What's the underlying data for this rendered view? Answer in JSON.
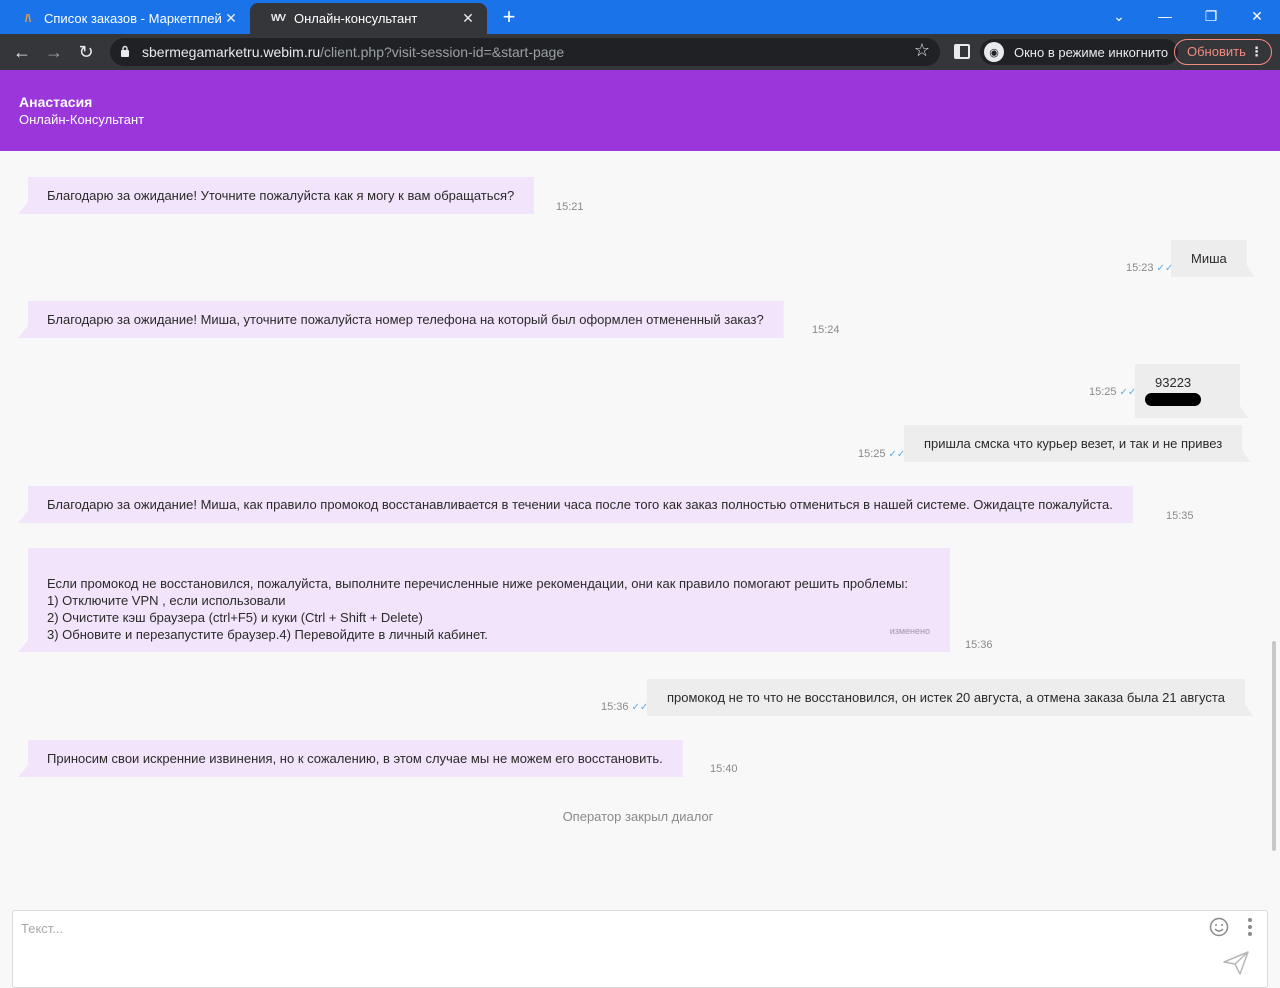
{
  "browser": {
    "tabs": [
      {
        "title": "Список заказов - Маркетплейс"
      },
      {
        "title": "Онлайн-консультант"
      }
    ],
    "url": {
      "host": "sbermegamarketru.webim.ru",
      "path": "/client.php?visit-session-id=&start-page"
    },
    "incognito_label": "Окно в режиме инкогнито",
    "update_label": "Обновить"
  },
  "operator": {
    "name": "Анастасия",
    "role": "Онлайн-Консультант"
  },
  "messages": [
    {
      "from": "operator",
      "text": "Благодарю за ожидание! Уточните пожалуйста как я могу к вам обращаться?",
      "time": "15:21"
    },
    {
      "from": "user",
      "text": "Миша",
      "time": "15:23"
    },
    {
      "from": "operator",
      "text": "Благодарю за ожидание! Миша, уточните пожалуйста номер телефона на который был оформлен отмененный заказ?",
      "time": "15:24"
    },
    {
      "from": "user",
      "text": "93223",
      "time": "15:25",
      "redacted": true
    },
    {
      "from": "user",
      "text": "пришла смска что курьер везет, и так и не привез",
      "time": "15:25"
    },
    {
      "from": "operator",
      "text": "Благодарю за ожидание! Миша, как правило промокод восстанавливается в течении часа после того как заказ полностью отмениться в нашей системе. Ожидацте пожалуйста.",
      "time": "15:35"
    },
    {
      "from": "operator",
      "text": "Если промокод не восстановился, пожалуйста, выполните перечисленные ниже рекомендации, они как правило помогают решить проблемы:\n1) Отключите VPN , если использовали\n2) Очистите кэш браузера (ctrl+F5) и куки (Ctrl + Shift + Delete)\n3) Обновите и перезапустите браузер.4) Перевойдите в личный кабинет.",
      "time": "15:36",
      "edited_label": "изменено"
    },
    {
      "from": "user",
      "text": "промокод не то что не восстановился, он истек 20 августа, а отмена заказа была 21 августа",
      "time": "15:36"
    },
    {
      "from": "operator",
      "text": "Приносим свои искренние извинения, но к сожалению, в этом случае мы не можем его восстановить.",
      "time": "15:40"
    }
  ],
  "closed_note": "Оператор закрыл диалог",
  "composer": {
    "placeholder": "Текст..."
  },
  "colors": {
    "header": "#9b36da",
    "operator_bubble": "#f2e4fa",
    "user_bubble": "#ededed",
    "chrome_tabbar": "#1a73e8"
  }
}
